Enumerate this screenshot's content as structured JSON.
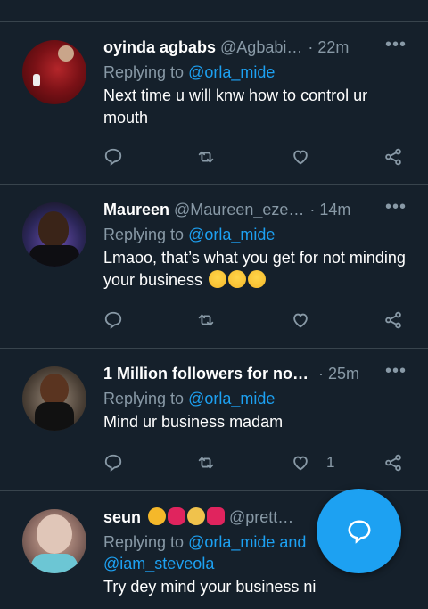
{
  "tweets": [
    {
      "name": "oyinda agbabs",
      "handle": "@Agbabi…",
      "sep": "·",
      "time": "22m",
      "replying_prefix": "Replying to ",
      "replying_to": "@orla_mide",
      "text": "Next time u will knw how to control ur mouth",
      "likes": ""
    },
    {
      "name": "Maureen",
      "handle": "@Maureen_eze…",
      "sep": "·",
      "time": "14m",
      "replying_prefix": "Replying to ",
      "replying_to": "@orla_mide",
      "text": "Lmaoo, that’s what you get for not minding your business",
      "likes": ""
    },
    {
      "name": "1 Million followers for no…",
      "handle": "",
      "sep": "·",
      "time": "25m",
      "replying_prefix": "Replying to ",
      "replying_to": "@orla_mide",
      "text": "Mind ur business madam",
      "likes": "1"
    },
    {
      "name": "seun",
      "handle": "@prett…",
      "sep": "",
      "time": "",
      "replying_prefix": "Replying to ",
      "replying_to": "@orla_mide and",
      "replying_to_2": "@iam_steveola",
      "text": "Try dey mind your business ni",
      "likes": ""
    }
  ],
  "icons": {
    "more": "more-icon",
    "reply": "reply-icon",
    "retweet": "retweet-icon",
    "like": "heart-icon",
    "share": "share-icon",
    "compose": "compose-reply-icon"
  },
  "colors": {
    "background": "#15202b",
    "divider": "#38444d",
    "muted": "#8899a6",
    "accent": "#1da1f2"
  }
}
